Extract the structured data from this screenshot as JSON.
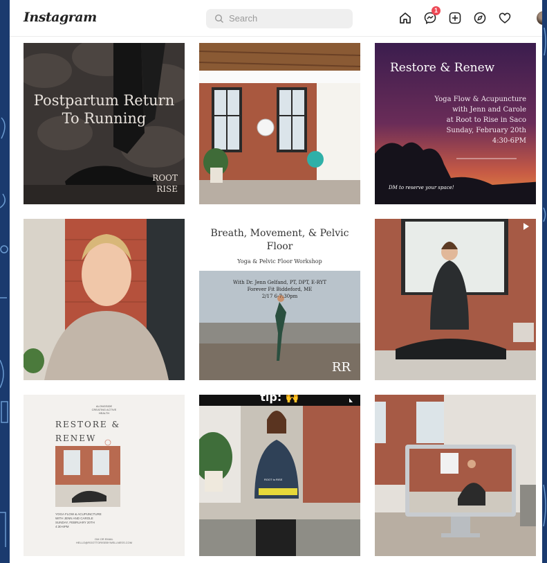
{
  "app": {
    "logo": "Instagram"
  },
  "search": {
    "placeholder": "Search"
  },
  "nav": {
    "notification_count": "1",
    "icons": [
      "home-icon",
      "messenger-icon",
      "new-post-icon",
      "explore-icon",
      "activity-icon",
      "profile-avatar"
    ]
  },
  "posts": [
    {
      "kind": "image",
      "title": "Postpartum Return To Running",
      "brand": "ROOT\nRISE"
    },
    {
      "kind": "image"
    },
    {
      "kind": "image",
      "title": "Restore & Renew",
      "body": "Yoga Flow & Acupuncture\nwith Jenn and Carole\nat Root to Rise in Saco\nSunday, February 20th\n4:30-6PM",
      "dm": "DM to reserve your space!"
    },
    {
      "kind": "image"
    },
    {
      "kind": "image",
      "title": "Breath, Movement, & Pelvic Floor",
      "subtitle": "Yoga & Pelvic Floor Workshop",
      "details": "With Dr. Jenn Gelfand, PT, DPT, E-RYT\nForever Fit Biddeford, ME\n2/17 6-7:30pm",
      "monogram": "RR"
    },
    {
      "kind": "video"
    },
    {
      "kind": "image",
      "title": "RESTORE &\nRENEW",
      "top_text": "ALONGSIDE\nCREATING ACTIVE\nHEALTH",
      "details": "YOGA FLOW & ACUPUNCTURE\nWITH JENN AND CAROLE\nSUNDAY, FEBRUARY 20TH\n4:30-6PM",
      "footer": "DM OR EMAIL\nHELLO@ROOTTORISEBYWELLNESS.COM"
    },
    {
      "kind": "video",
      "caption": "tip: 🙌",
      "shirt_text": "ROOT to RISE"
    },
    {
      "kind": "video"
    }
  ]
}
